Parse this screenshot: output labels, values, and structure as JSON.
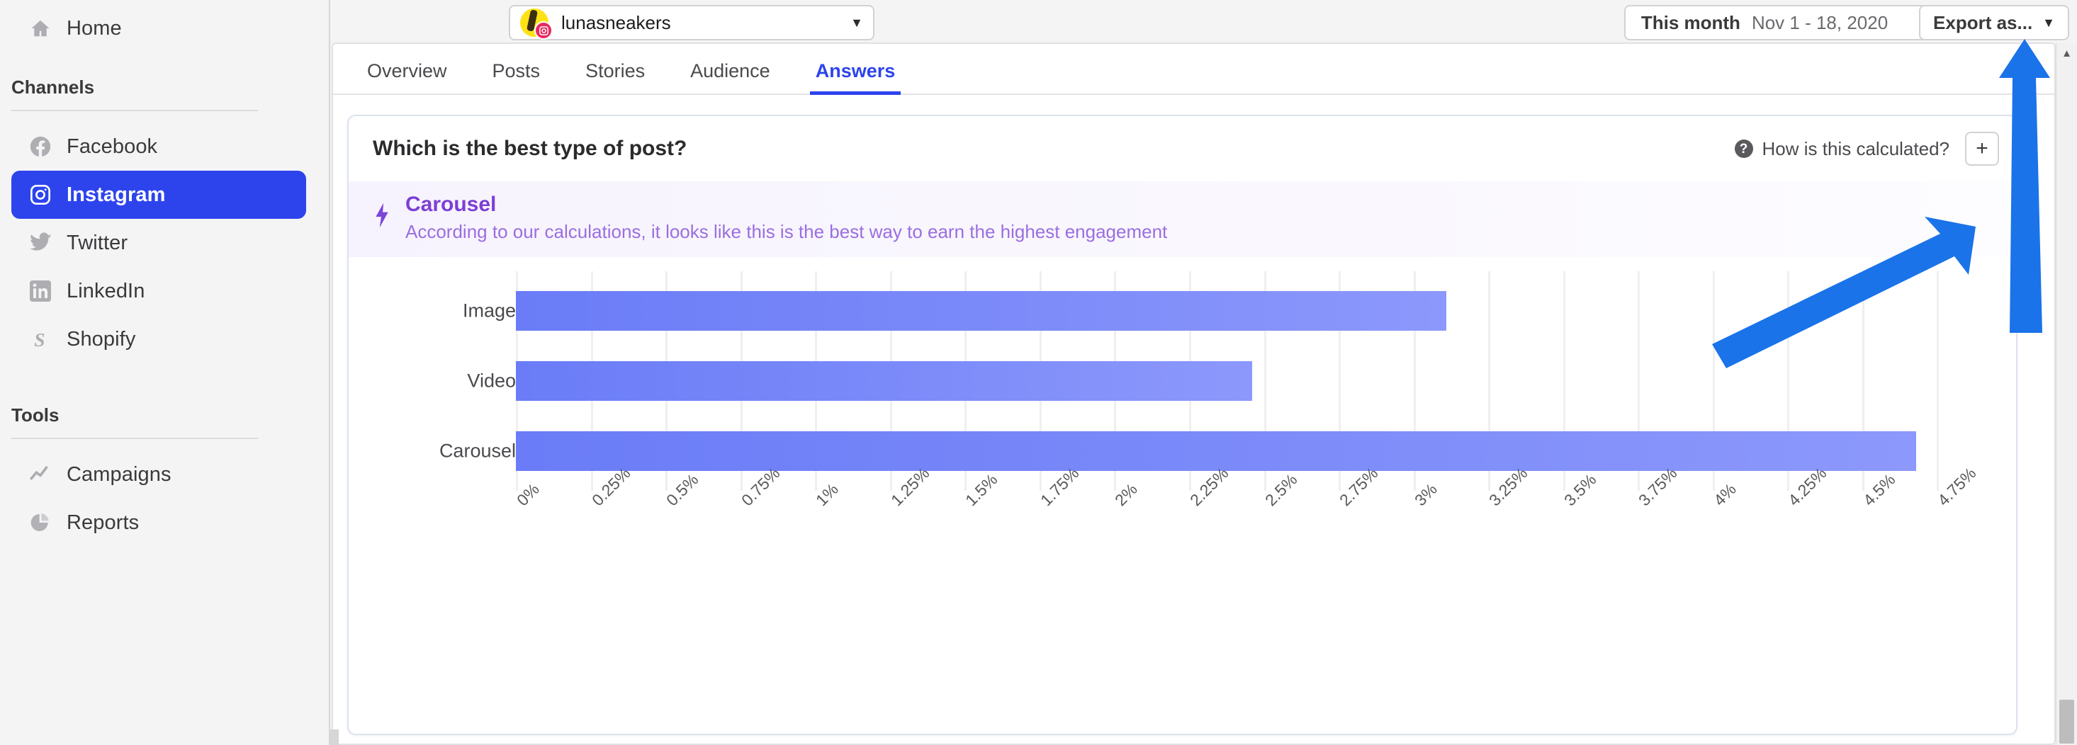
{
  "sidebar": {
    "home": {
      "label": "Home",
      "icon": "home-icon"
    },
    "channels_heading": "Channels",
    "channels": [
      {
        "label": "Facebook",
        "icon": "facebook-icon",
        "active": false
      },
      {
        "label": "Instagram",
        "icon": "instagram-icon",
        "active": true
      },
      {
        "label": "Twitter",
        "icon": "twitter-icon",
        "active": false
      },
      {
        "label": "LinkedIn",
        "icon": "linkedin-icon",
        "active": false
      },
      {
        "label": "Shopify",
        "icon": "shopify-icon",
        "active": false
      }
    ],
    "tools_heading": "Tools",
    "tools": [
      {
        "label": "Campaigns",
        "icon": "trend-line-icon"
      },
      {
        "label": "Reports",
        "icon": "pie-chart-icon"
      }
    ]
  },
  "topbar": {
    "account": {
      "name": "lunasneakers",
      "avatar_badge": "instagram-icon",
      "caret": "▼"
    },
    "date_picker": {
      "preset": "This month",
      "range": "Nov 1 - 18, 2020",
      "caret": "▼"
    },
    "export": {
      "label": "Export as...",
      "caret": "▼"
    }
  },
  "tabs": [
    {
      "label": "Overview",
      "active": false
    },
    {
      "label": "Posts",
      "active": false
    },
    {
      "label": "Stories",
      "active": false
    },
    {
      "label": "Audience",
      "active": false
    },
    {
      "label": "Answers",
      "active": true
    }
  ],
  "card": {
    "title": "Which is the best type of post?",
    "help_label": "How is this calculated?",
    "help_icon": "question-mark-icon",
    "add_label": "+",
    "insight": {
      "icon": "lightning-bolt-icon",
      "title": "Carousel",
      "subtitle": "According to our calculations, it looks like this is the best way to earn the highest engagement"
    }
  },
  "chart_data": {
    "type": "bar",
    "orientation": "horizontal",
    "title": "Which is the best type of post?",
    "xlabel": "",
    "ylabel": "",
    "categories": [
      "Image",
      "Video",
      "Carousel"
    ],
    "values": [
      3.11,
      2.46,
      4.68
    ],
    "unit": "%",
    "xlim": [
      0,
      5.0
    ],
    "tick_labels": [
      "0%",
      "0.25%",
      "0.5%",
      "0.75%",
      "1%",
      "1.25%",
      "1.5%",
      "1.75%",
      "2%",
      "2.25%",
      "2.5%",
      "2.75%",
      "3%",
      "3.25%",
      "3.5%",
      "3.75%",
      "4%",
      "4.25%",
      "4.5%",
      "4.75%"
    ],
    "tick_values": [
      0,
      0.25,
      0.5,
      0.75,
      1,
      1.25,
      1.5,
      1.75,
      2,
      2.25,
      2.5,
      2.75,
      3,
      3.25,
      3.5,
      3.75,
      4,
      4.25,
      4.5,
      4.75
    ],
    "grid": true,
    "legend": false,
    "bar_color": "#6a7cf7",
    "bar_color_end": "#8c98fb"
  },
  "colors": {
    "accent": "#2d44ec",
    "insight_purple": "#7c3fd4",
    "bar_blue": "#6a7cf7",
    "annotation_blue": "#1a73e8"
  },
  "scrollbar": {
    "up_arrow": "▲"
  }
}
